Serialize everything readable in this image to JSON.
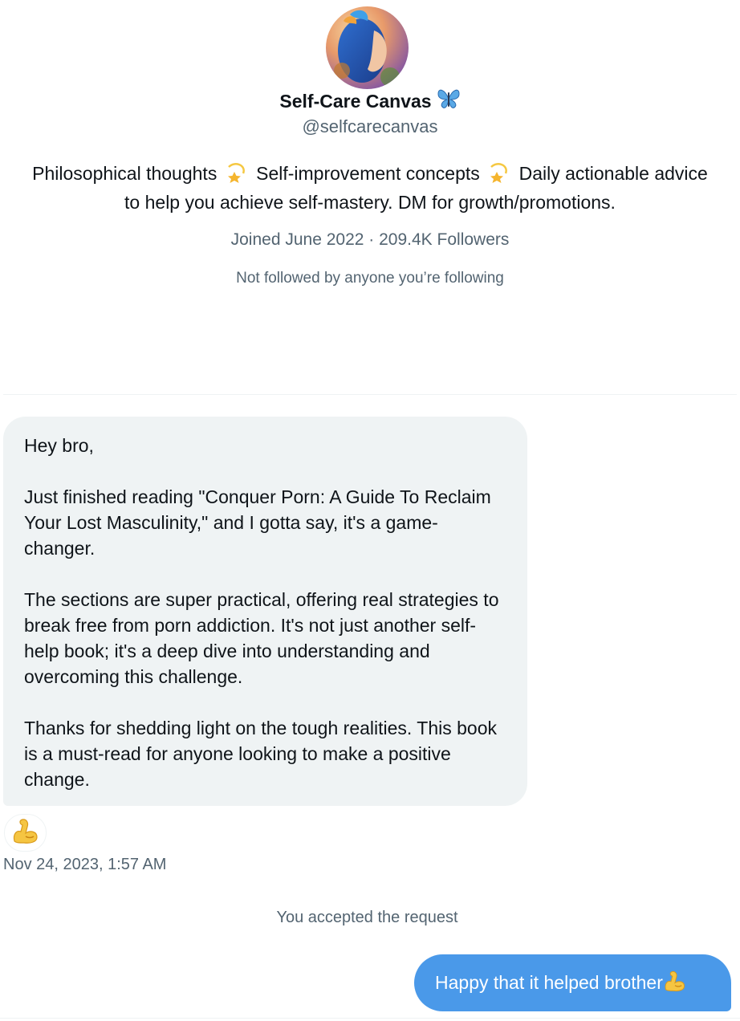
{
  "profile": {
    "display_name": "Self-Care Canvas",
    "verified_icon": "butterfly-emoji",
    "handle": "@selfcarecanvas",
    "bio_parts": [
      "Philosophical thoughts",
      "Self-improvement concepts",
      "Daily actionable advice to help you achieve self-mastery. DM for growth/promotions."
    ],
    "bio_separator_icon": "dizzy-star-emoji",
    "joined": "Joined June 2022",
    "separator": "·",
    "followers": "209.4K Followers",
    "mutuals": "Not followed by anyone you’re following"
  },
  "incoming_message": {
    "paragraphs": [
      "Hey bro,",
      "Just finished reading \"Conquer Porn: A Guide To Reclaim Your Lost Masculinity,\" and I gotta say, it's a game-changer.",
      "The sections are super practical, offering real strategies to break free from porn addiction. It's not just another self-help book; it's a deep dive into understanding and overcoming this challenge.",
      "Thanks for shedding light on the tough realities. This book is a must-read for anyone looking to make a positive change."
    ],
    "reaction_icon": "flexed-biceps-emoji",
    "timestamp": "Nov 24, 2023, 1:57 AM"
  },
  "system_notice": "You accepted the request",
  "outgoing_message": {
    "text": "Happy that it helped brother",
    "emoji_icon": "flexed-biceps-emoji"
  },
  "colors": {
    "incoming_bubble": "#eff3f4",
    "outgoing_bubble": "#4a99e9",
    "secondary_text": "#536471",
    "primary_text": "#0f1419"
  }
}
